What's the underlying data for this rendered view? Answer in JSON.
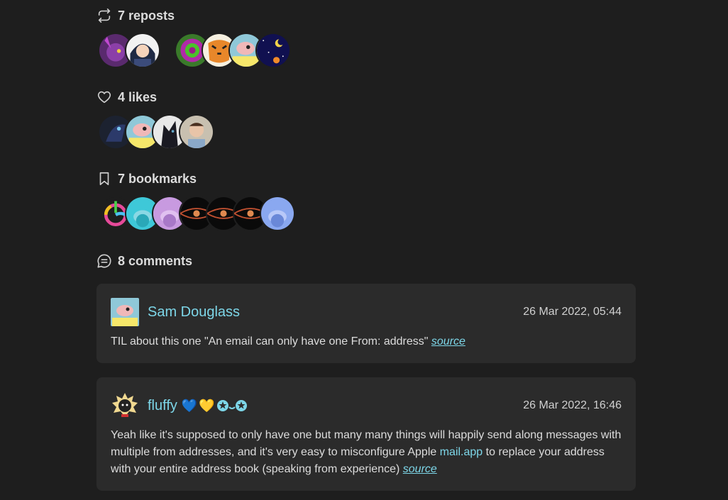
{
  "reposts": {
    "label": "7 reposts",
    "icon": "repost-icon"
  },
  "likes": {
    "label": "4 likes",
    "icon": "heart-icon"
  },
  "bookmarks": {
    "label": "7 bookmarks",
    "icon": "bookmark-icon"
  },
  "comments": {
    "label": "8 comments",
    "icon": "comment-icon",
    "items": [
      {
        "author": "Sam Douglass",
        "date": "26 Mar 2022, 05:44",
        "text": "TIL about this one \"An email can only have one From: address\"",
        "source_label": "source"
      },
      {
        "author": "fluffy",
        "emoji": [
          "💙",
          "💛"
        ],
        "date": "26 Mar 2022, 16:46",
        "text_before": "Yeah like it's supposed to only have one but many many things will happily send along messages with multiple from addresses, and it's very easy to misconfigure Apple",
        "link": "mail.app",
        "text_after": "to replace your address with your entire address book (speaking from experience)",
        "source_label": "source"
      }
    ]
  },
  "colors": {
    "accent": "#7dd6e8",
    "background": "#1e1e1e",
    "card": "#2b2b2b"
  }
}
